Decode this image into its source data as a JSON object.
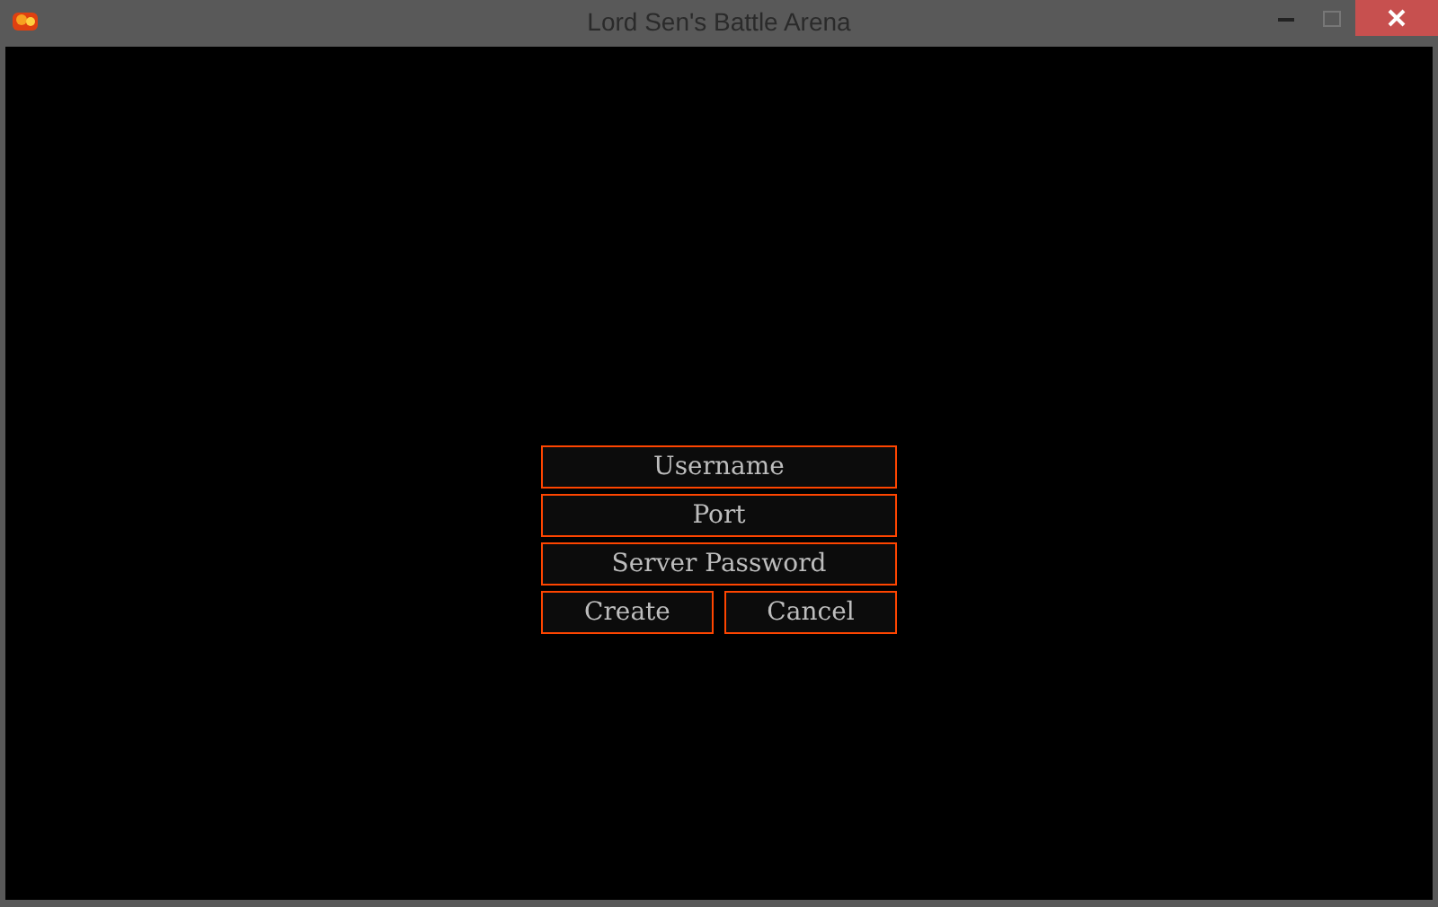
{
  "window": {
    "title": "Lord Sen's Battle Arena"
  },
  "fields": [
    {
      "placeholder": "Username"
    },
    {
      "placeholder": "Port"
    },
    {
      "placeholder": "Server Password"
    }
  ],
  "buttons": [
    {
      "label": "Create"
    },
    {
      "label": "Cancel"
    }
  ]
}
